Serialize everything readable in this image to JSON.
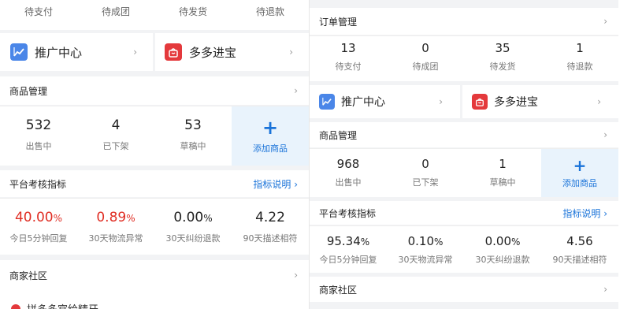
{
  "colors": {
    "accent": "#1a73d9",
    "red": "#e02e24",
    "brand_orange": "#e4393c",
    "blue_icon": "#4a86e8"
  },
  "left": {
    "order_tabs": [
      "待支付",
      "待成团",
      "待发货",
      "待退款"
    ],
    "promo": {
      "promote": {
        "label": "推广中心",
        "icon": "trend-chart-icon"
      },
      "duoduo": {
        "label": "多多进宝",
        "icon": "shopping-bag-icon"
      }
    },
    "products": {
      "title": "商品管理",
      "stats": [
        {
          "value": "532",
          "label": "出售中"
        },
        {
          "value": "4",
          "label": "已下架"
        },
        {
          "value": "53",
          "label": "草稿中"
        }
      ],
      "add_label": "添加商品"
    },
    "metrics": {
      "title": "平台考核指标",
      "link": "指标说明",
      "items": [
        {
          "value": "40.00",
          "unit": "%",
          "label": "今日5分钟回复"
        },
        {
          "value": "0.89",
          "unit": "%",
          "label": "30天物流异常"
        },
        {
          "value": "0.00",
          "unit": "%",
          "label": "30天纠纷退款"
        },
        {
          "value": "4.22",
          "unit": "",
          "label": "90天描述相符"
        }
      ]
    },
    "community": {
      "title": "商家社区",
      "snippet": "拼多多官给精牙"
    }
  },
  "right": {
    "orders": {
      "title": "订单管理",
      "items": [
        {
          "value": "13",
          "label": "待支付"
        },
        {
          "value": "0",
          "label": "待成团"
        },
        {
          "value": "35",
          "label": "待发货"
        },
        {
          "value": "1",
          "label": "待退款"
        }
      ]
    },
    "promo": {
      "promote": {
        "label": "推广中心",
        "icon": "trend-chart-icon"
      },
      "duoduo": {
        "label": "多多进宝",
        "icon": "shopping-bag-icon"
      }
    },
    "products": {
      "title": "商品管理",
      "stats": [
        {
          "value": "968",
          "label": "出售中"
        },
        {
          "value": "0",
          "label": "已下架"
        },
        {
          "value": "1",
          "label": "草稿中"
        }
      ],
      "add_label": "添加商品"
    },
    "metrics": {
      "title": "平台考核指标",
      "link": "指标说明",
      "items": [
        {
          "value": "95.34",
          "unit": "%",
          "label": "今日5分钟回复"
        },
        {
          "value": "0.10",
          "unit": "%",
          "label": "30天物流异常"
        },
        {
          "value": "0.00",
          "unit": "%",
          "label": "30天纠纷退款"
        },
        {
          "value": "4.56",
          "unit": "",
          "label": "90天描述相符"
        }
      ]
    },
    "community": {
      "title": "商家社区"
    }
  },
  "icons": {
    "chevron": "›"
  }
}
